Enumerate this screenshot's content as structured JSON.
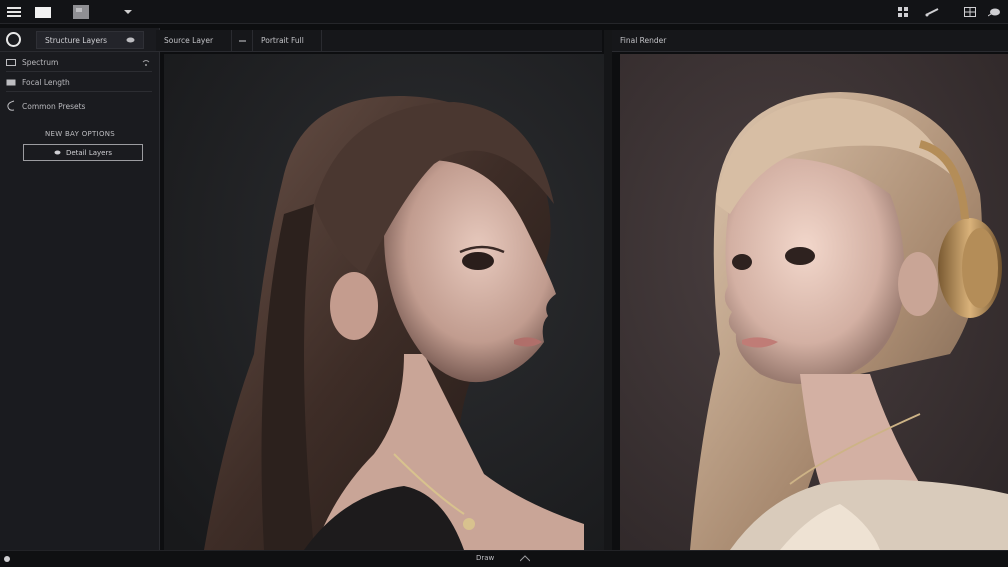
{
  "toolbar": {
    "icons": [
      "menu-icon",
      "window-icon",
      "image-icon",
      "dropdown-icon"
    ],
    "right_icons": [
      "grid-icon",
      "brush-icon",
      "layout-icon",
      "leaf-icon"
    ]
  },
  "sidebar": {
    "header_label": "Structure Layers",
    "items": [
      {
        "label": "Spectrum",
        "icon": "layers-icon"
      },
      {
        "label": "Focal Length",
        "icon": "folder-icon"
      },
      {
        "label": "Common Presets",
        "icon": "curve-icon"
      }
    ],
    "section_label": "NEW BAY OPTIONS",
    "action_button": "Detail Layers"
  },
  "left_panel": {
    "tabs": [
      "Source Layer",
      "Portrait Full"
    ]
  },
  "right_panel": {
    "tab": "Final Render"
  },
  "status": {
    "center_label": "Draw"
  },
  "colors": {
    "background": "#0d0e10",
    "panel": "#1a1b1f",
    "viewport_left": "#222326",
    "viewport_right": "#3a3132"
  }
}
